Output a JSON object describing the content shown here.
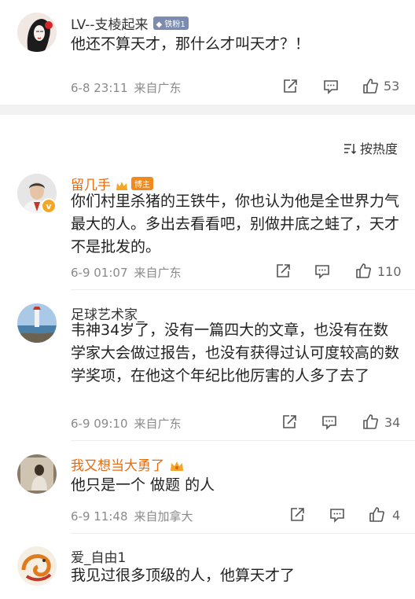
{
  "sort": {
    "label": "按热度"
  },
  "comments": [
    {
      "username": "LV--支棱起来",
      "badge": "铁粉1",
      "text": "他还不算天才，那什么才叫天才？！",
      "time": "6-8 23:11",
      "location": "来自广东",
      "likes": "53"
    },
    {
      "username": "留几手",
      "badge": "博主",
      "text": "你们村里杀猪的王铁牛，你也认为他是全世界力气最大的人。多出去看看吧，别做井底之蛙了，天才不是批发的。",
      "time": "6-9 01:07",
      "location": "来自广东",
      "likes": "110"
    },
    {
      "username": "足球艺术家_",
      "text": "韦神34岁了，没有一篇四大的文章，也没有在数学家大会做过报告，也没有获得过认可度较高的数学奖项，在他这个年纪比他厉害的人多了去了",
      "time": "6-9 09:10",
      "location": "来自广东",
      "likes": "34"
    },
    {
      "username": "我又想当大勇了",
      "text": "他只是一个 做题 的人",
      "time": "6-9 11:48",
      "location": "来自加拿大",
      "likes": "4"
    },
    {
      "username": "爱_自由1",
      "text": "我见过很多顶级的人，他算天才了"
    }
  ],
  "colors": {
    "orange_name": "#e86b0f",
    "gray_text": "#8a8a8a"
  }
}
